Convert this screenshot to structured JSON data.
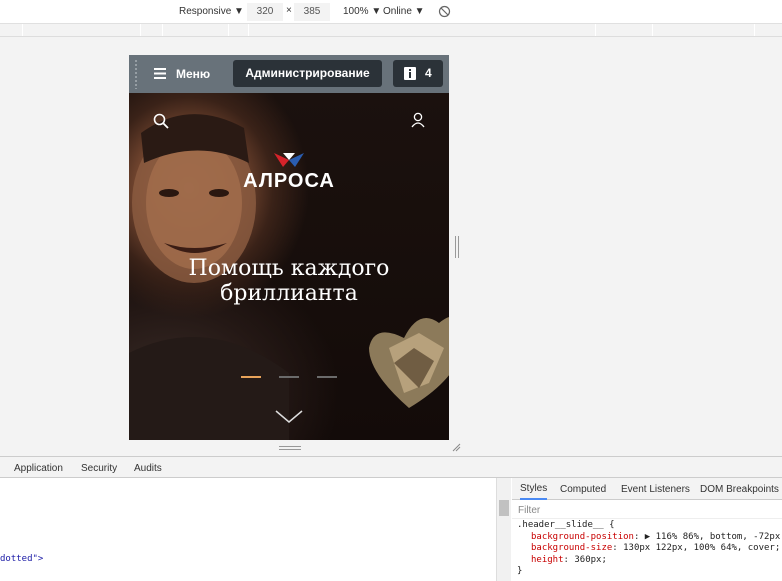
{
  "toolbar": {
    "device": "Responsive ▼",
    "width": "320",
    "times": "×",
    "height": "385",
    "zoom": "100% ▼",
    "network": "Online ▼",
    "rotate_icon": "rotate-icon"
  },
  "admin_bar": {
    "menu_label": "Меню",
    "admin_button": "Администрирование",
    "notifications_count": "4"
  },
  "hero": {
    "logo_text": "АЛРОСА",
    "title_line1": "Помощь каждого",
    "title_line2": "бриллианта",
    "active_slide": 1,
    "slides_total": 3
  },
  "devtools": {
    "tabs": [
      "Application",
      "Security",
      "Audits"
    ],
    "code_fragment": "dotted\">",
    "styles_tabs": [
      "Styles",
      "Computed",
      "Event Listeners",
      "DOM Breakpoints"
    ],
    "filter_placeholder": "Filter",
    "rule_selector": ".header__slide__ {",
    "rules": [
      {
        "prop": "background-position",
        "value": "▶ 116% 86%, bottom, -72px;"
      },
      {
        "prop": "background-size",
        "value": "130px 122px, 100% 64%, cover;"
      },
      {
        "prop": "height",
        "value": "360px;"
      }
    ],
    "rule_close": "}"
  },
  "colors": {
    "accent_dot": "#e8a35a",
    "admin_bar": "#68727a",
    "admin_button": "#2b3238"
  }
}
